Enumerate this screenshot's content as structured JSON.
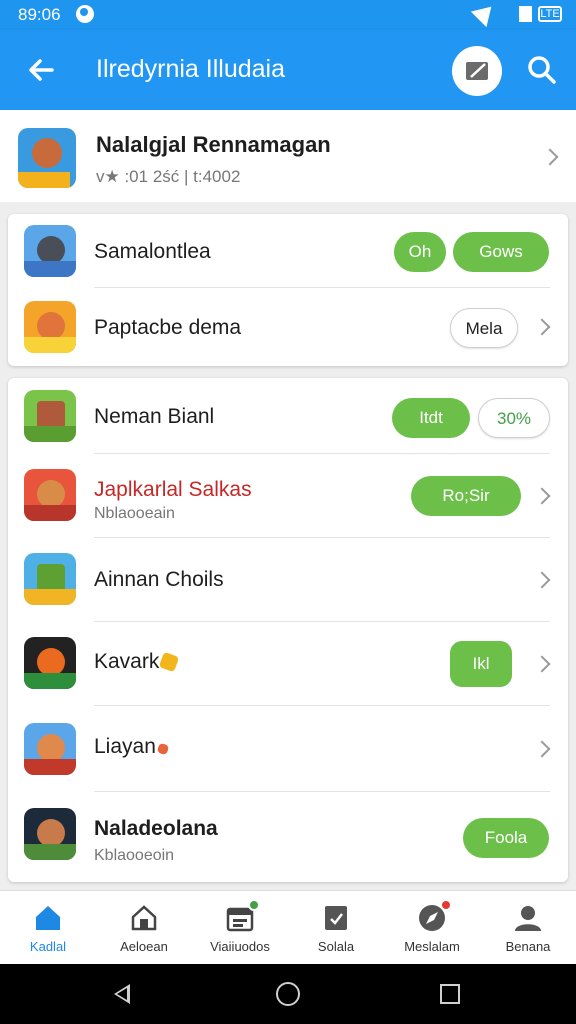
{
  "status_bar": {
    "time": "89:06"
  },
  "app_bar": {
    "title": "Ilredyrnia Illudaia",
    "icons": {
      "back": "arrow-left-icon",
      "edit": "edit-icon",
      "search": "search-icon"
    }
  },
  "header_item": {
    "name": "Nalalgjal Rennamagan",
    "sub": "v★ :01 2ść | t:4002"
  },
  "group1": [
    {
      "name": "Samalontlea",
      "buttons": [
        "Oh",
        "Gows"
      ]
    },
    {
      "name": "Paptacbe dema",
      "buttons": [
        "Mela"
      ]
    }
  ],
  "group2": [
    {
      "name": "Neman Bianl",
      "buttons": [
        "Itdt",
        "30%"
      ]
    },
    {
      "name": "Japlkarlal Salkas",
      "sub": "Nblaooeain",
      "buttons": [
        "Ro;Sir"
      ]
    },
    {
      "name": "Ainnan Choils"
    },
    {
      "name": "Kavark",
      "buttons": [
        "Ikl"
      ]
    },
    {
      "name": "Liayan"
    },
    {
      "name": "Naladeolana",
      "sub": "Kblaooeoin",
      "buttons": [
        "Foola"
      ]
    }
  ],
  "bottom_nav": [
    {
      "label": "Kadlal",
      "icon": "home-icon"
    },
    {
      "label": "Aeloean",
      "icon": "house-outline-icon"
    },
    {
      "label": "Viaiiuodos",
      "icon": "calendar-icon"
    },
    {
      "label": "Solala",
      "icon": "tag-icon"
    },
    {
      "label": "Meslalam",
      "icon": "compass-icon"
    },
    {
      "label": "Benana",
      "icon": "person-icon"
    }
  ],
  "colors": {
    "primary": "#2196f3",
    "accent_green": "#6cc04a",
    "red_title": "#c62828",
    "active_nav": "#1e88e5"
  }
}
